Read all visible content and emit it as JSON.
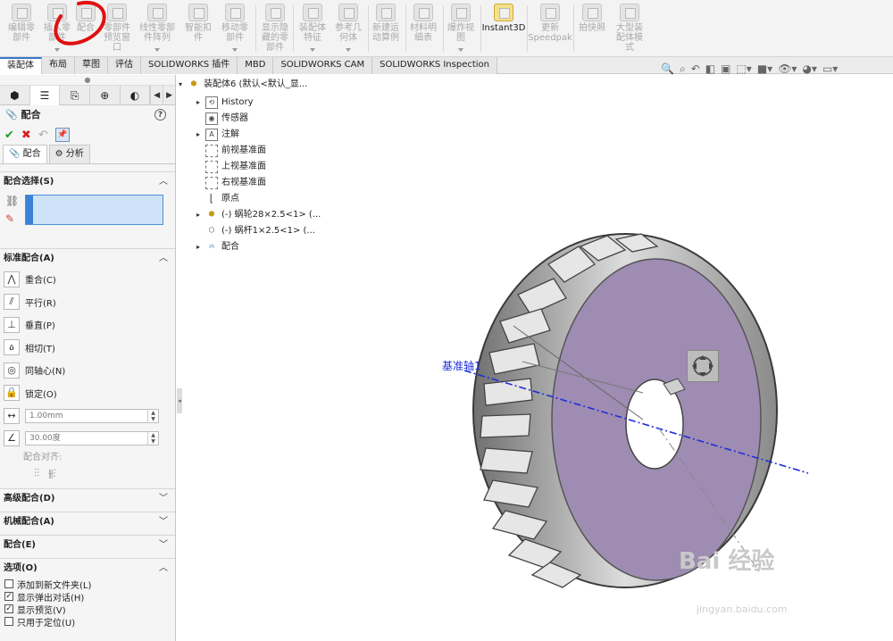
{
  "ribbon": {
    "buttons": [
      {
        "label": "编辑零\n部件",
        "state": "disabled"
      },
      {
        "label": "插入零\n部件",
        "state": "disabled"
      },
      {
        "label": "配合",
        "state": "active"
      },
      {
        "label": "零部件\n预览窗\n口",
        "state": "disabled"
      },
      {
        "label": "线性零部\n件阵列",
        "state": "disabled"
      },
      {
        "label": "智能扣\n件",
        "state": "disabled"
      },
      {
        "label": "移动零\n部件",
        "state": "disabled"
      },
      {
        "label": "显示隐\n藏的零\n部件",
        "state": "disabled"
      },
      {
        "label": "装配体\n特征",
        "state": "disabled"
      },
      {
        "label": "参考几\n何体",
        "state": "disabled"
      },
      {
        "label": "新建运\n动算例",
        "state": "disabled"
      },
      {
        "label": "材料明\n细表",
        "state": "disabled"
      },
      {
        "label": "爆炸视\n图",
        "state": "disabled"
      },
      {
        "label": "Instant3D",
        "state": "normal"
      },
      {
        "label": "更新\nSpeedpak",
        "state": "disabled"
      },
      {
        "label": "拍快照",
        "state": "disabled"
      },
      {
        "label": "大型装\n配体模\n式",
        "state": "disabled"
      }
    ]
  },
  "tabs": [
    "装配体",
    "布局",
    "草图",
    "评估",
    "SOLIDWORKS 插件",
    "MBD",
    "SOLIDWORKS CAM",
    "SOLIDWORKS Inspection"
  ],
  "panel": {
    "title": "配合",
    "help": "?",
    "subtabs": [
      "配合",
      "分析"
    ],
    "sections": {
      "selection": "配合选择(S)",
      "standard": "标准配合(A)",
      "advanced": "高级配合(D)",
      "mechanical": "机械配合(A)",
      "mates": "配合(E)",
      "options": "选项(O)"
    },
    "standard_mates": [
      "重合(C)",
      "平行(R)",
      "垂直(P)",
      "相切(T)",
      "同轴心(N)",
      "锁定(O)"
    ],
    "distance_value": "1.00mm",
    "angle_value": "30.00度",
    "mate_alignment": "配合对齐:",
    "options": [
      {
        "label": "添加到新文件夹(L)",
        "checked": false
      },
      {
        "label": "显示弹出对话(H)",
        "checked": true
      },
      {
        "label": "显示预览(V)",
        "checked": true
      },
      {
        "label": "只用于定位(U)",
        "checked": false
      }
    ]
  },
  "tree": {
    "root": "装配体6  (默认<默认_显...",
    "items": [
      {
        "label": "History",
        "expandable": true
      },
      {
        "label": "传感器",
        "expandable": false
      },
      {
        "label": "注解",
        "expandable": true
      },
      {
        "label": "前视基准面",
        "expandable": false
      },
      {
        "label": "上视基准面",
        "expandable": false
      },
      {
        "label": "右视基准面",
        "expandable": false
      },
      {
        "label": "原点",
        "expandable": false
      },
      {
        "label": "(-) 蜗轮28×2.5<1> (...",
        "expandable": true
      },
      {
        "label": "(-) 蜗杆1×2.5<1> (...",
        "expandable": false
      },
      {
        "label": "配合",
        "expandable": true
      }
    ]
  },
  "viewport": {
    "axis_label": "基准轴1",
    "watermark": "Bai 经验",
    "watermark_sub": "jingyan.baidu.com"
  },
  "colors": {
    "gear_face": "#9f8cb2",
    "axis": "#1d2fd8",
    "annotation": "#e01010"
  }
}
